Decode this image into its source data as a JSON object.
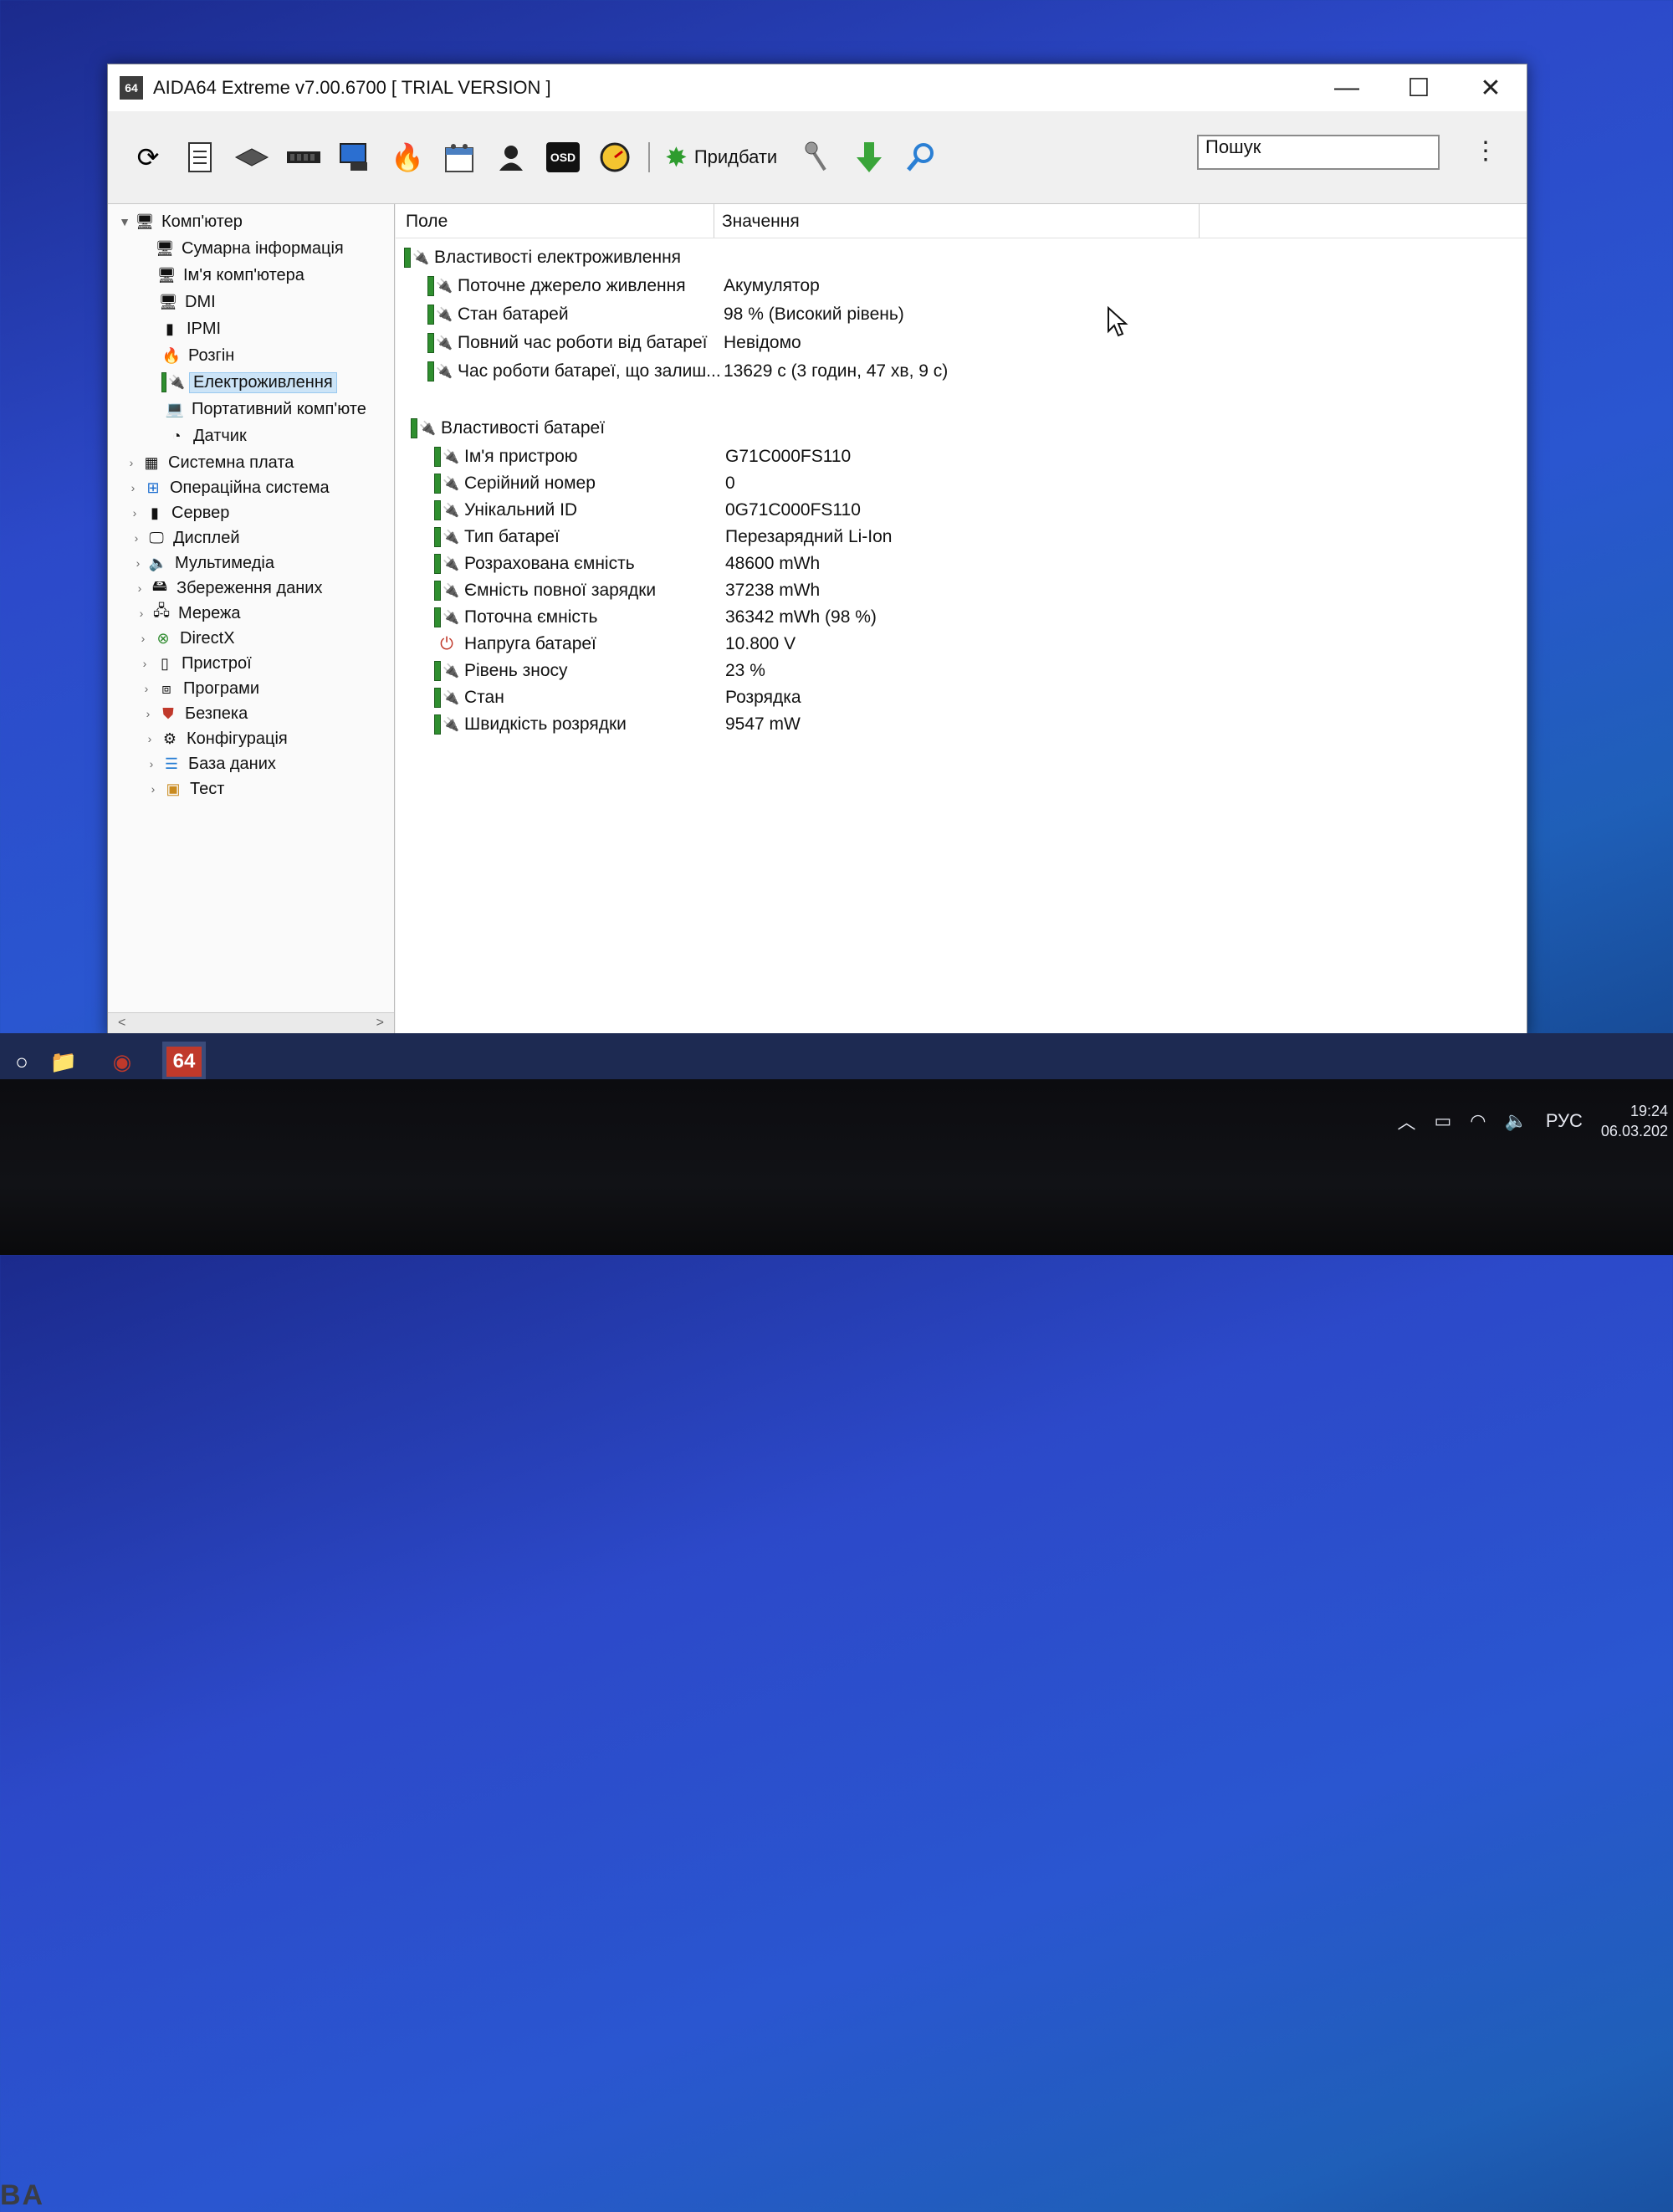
{
  "window": {
    "title": "AIDA64 Extreme v7.00.6700  [ TRIAL VERSION ]",
    "app_icon_text": "64",
    "controls": {
      "minimize": "—",
      "maximize": "☐",
      "close": "✕"
    }
  },
  "toolbar": {
    "buy_label": "Придбати",
    "osd_label": "OSD",
    "search_value": "Пошук"
  },
  "tree": {
    "root": "Комп'ютер",
    "children": [
      "Сумарна інформація",
      "Ім'я комп'ютера",
      "DMI",
      "IPMI",
      "Розгін",
      "Електроживлення",
      "Портативний комп'юте",
      "Датчик"
    ],
    "selected": "Електроживлення",
    "groups": [
      "Системна плата",
      "Операційна система",
      "Сервер",
      "Дисплей",
      "Мультимедіа",
      "Збереження даних",
      "Мережа",
      "DirectX",
      "Пристрої",
      "Програми",
      "Безпека",
      "Конфігурація",
      "База даних",
      "Тест"
    ],
    "scroll_left": "<",
    "scroll_right": ">"
  },
  "content": {
    "col_field": "Поле",
    "col_value": "Значення",
    "section1": {
      "title": "Властивості електроживлення",
      "rows": [
        {
          "field": "Поточне джерело живлення",
          "value": "Акумулятор"
        },
        {
          "field": "Стан батарей",
          "value": "98 % (Високий рівень)"
        },
        {
          "field": "Повний час роботи від батареї",
          "value": "Невідомо"
        },
        {
          "field": "Час роботи батареї, що залиш...",
          "value": "13629 с (3 годин, 47 хв, 9 с)"
        }
      ]
    },
    "section2": {
      "title": "Властивості батареї",
      "rows": [
        {
          "field": "Ім'я пристрою",
          "value": "G71C000FS110"
        },
        {
          "field": "Серійний номер",
          "value": "0"
        },
        {
          "field": "Унікальний ID",
          "value": "0G71C000FS110"
        },
        {
          "field": "Тип батареї",
          "value": "Перезарядний Li-Ion"
        },
        {
          "field": "Розрахована ємність",
          "value": "48600 mWh"
        },
        {
          "field": "Ємність повної зарядки",
          "value": "37238 mWh"
        },
        {
          "field": "Поточна ємність",
          "value": "36342 mWh  (98 %)"
        },
        {
          "field": "Напруга батареї",
          "value": "10.800 V"
        },
        {
          "field": "Рівень зносу",
          "value": "23 %"
        },
        {
          "field": "Стан",
          "value": "Розрядка"
        },
        {
          "field": "Швидкість розрядки",
          "value": "9547 mW"
        }
      ]
    }
  },
  "taskbar": {
    "app_label": "64",
    "language": "РУС",
    "time": "19:24",
    "date": "06.03.202"
  },
  "bezel": {
    "brand": "BA"
  },
  "colors": {
    "accent": "#2f8f2f",
    "selection": "#cce4f7",
    "desktop": "#2a56d0"
  }
}
